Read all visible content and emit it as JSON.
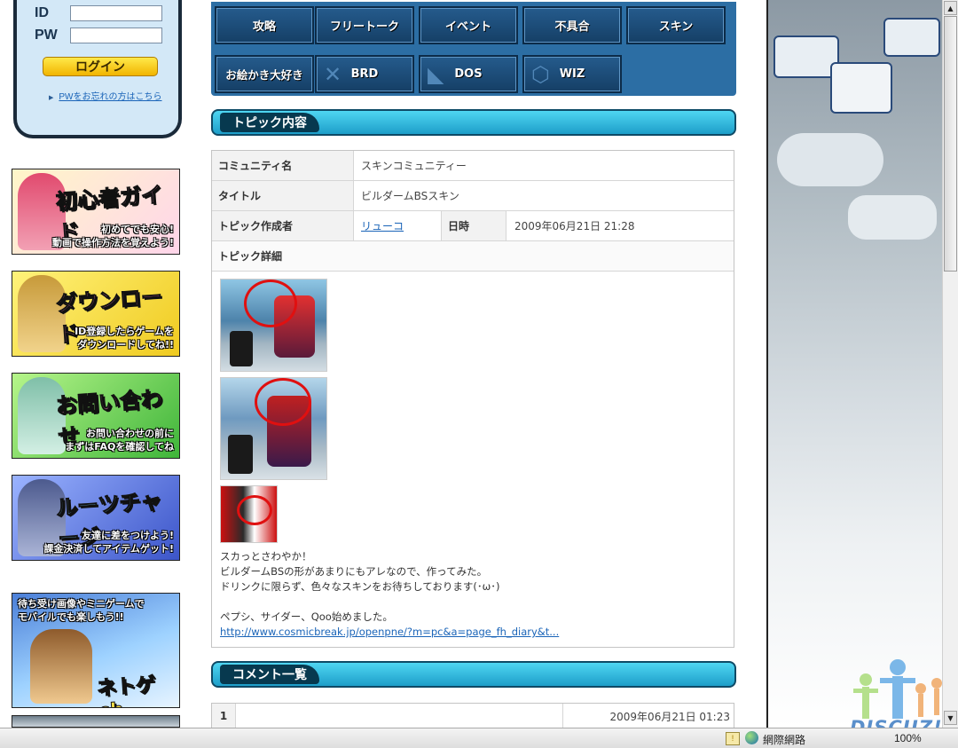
{
  "login": {
    "id_label": "ID",
    "pw_label": "PW",
    "button_label": "ログイン",
    "forgot_link": "PWをお忘れの方はこちら"
  },
  "banners": [
    {
      "title": "初心者ガイド",
      "sub1": "初めてでも安心!",
      "sub2": "動画で操作方法を覚えよう!"
    },
    {
      "title": "ダウンロード",
      "sub1": "ID登録したらゲームを",
      "sub2": "ダウンロードしてね!!"
    },
    {
      "title": "お問い合わせ",
      "sub1": "お問い合わせの前に",
      "sub2": "まずはFAQを確認してね"
    },
    {
      "title": "ルーツチャージ",
      "sub1": "友達に差をつけよう!",
      "sub2": "課金決済してアイテムゲット!"
    },
    {
      "title": "ネトゲch",
      "sub1": "待ち受け画像やミニゲームで",
      "sub2": "モバイルでも楽しもう!!"
    }
  ],
  "tabs": [
    "攻略",
    "フリートーク",
    "イベント",
    "不具合",
    "スキン",
    "お絵かき大好き",
    "BRD",
    "DOS",
    "WIZ"
  ],
  "sections": {
    "topic": "トピック内容",
    "comments": "コメント一覧"
  },
  "topic": {
    "community_label": "コミュニティ名",
    "community_value": "スキンコミュニティー",
    "title_label": "タイトル",
    "title_value": "ビルダームBSスキン",
    "author_label": "トピック作成者",
    "author_value": "リューコ",
    "date_label": "日時",
    "date_value": "2009年06月21日 21:28",
    "detail_label": "トピック詳細",
    "body_lines": [
      "スカっとさわやか！",
      "ビルダームBSの形があまりにもアレなので、作ってみた。",
      "ドリンクに限らず、色々なスキンをお待ちしております(･ω･)",
      "",
      "ペプシ、サイダー、Qoo始めました。"
    ],
    "link": "http://www.cosmicbreak.jp/openpne/?m=pc&a=page_fh_diary&t..."
  },
  "comment": {
    "number": "1",
    "date": "2009年06月21日 01:23"
  },
  "statusbar": {
    "zone": "網際網路",
    "zoom": "100%"
  },
  "watermark": "DISCUZ!",
  "colors": {
    "tab_bg": "#1d4c7a",
    "tab_panel": "#2c6ea4",
    "header_cyan": "#2fb8dd",
    "link": "#1a64b8",
    "mark_red": "#e01010"
  }
}
